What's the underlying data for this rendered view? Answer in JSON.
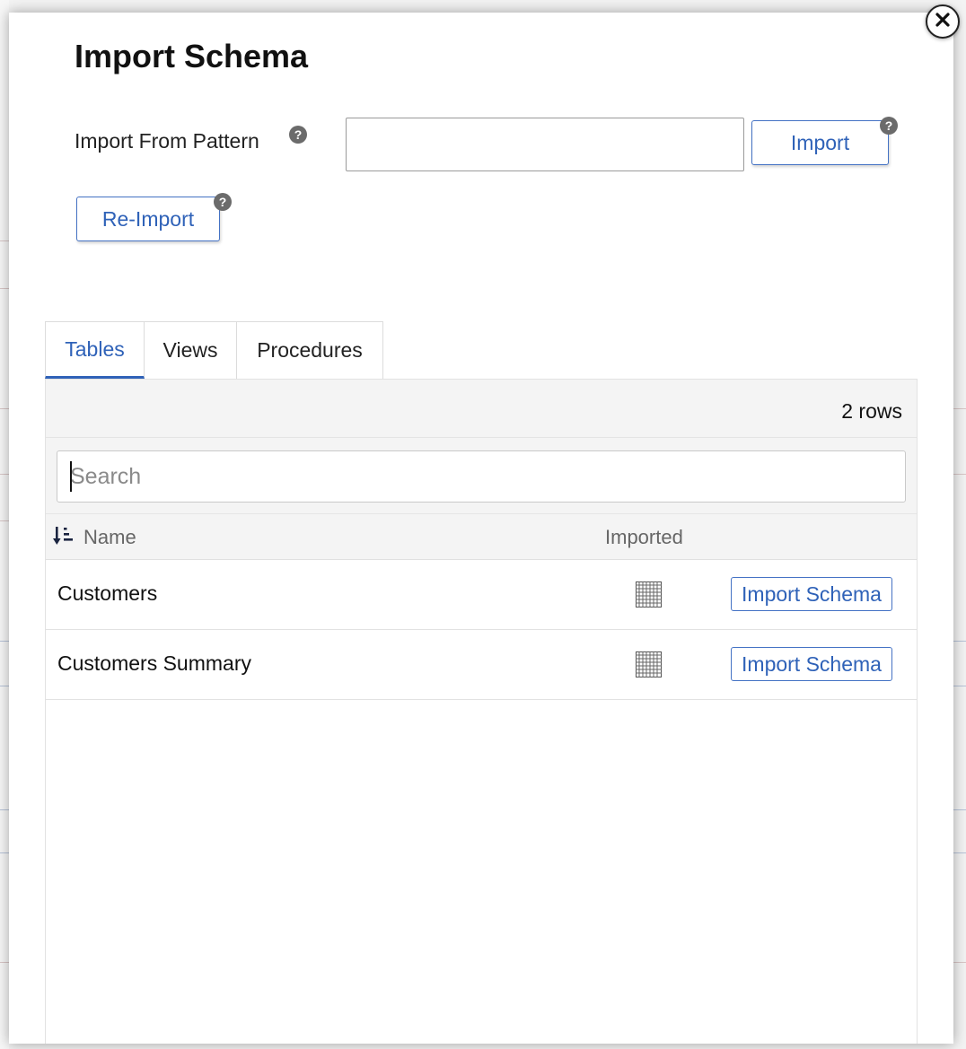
{
  "modal": {
    "title": "Import Schema",
    "close_icon": "close-icon"
  },
  "pattern": {
    "label": "Import From Pattern",
    "input_value": "",
    "import_label": "Import",
    "reimport_label": "Re-Import",
    "help_glyph": "?"
  },
  "tabs": [
    {
      "label": "Tables",
      "active": true
    },
    {
      "label": "Views",
      "active": false
    },
    {
      "label": "Procedures",
      "active": false
    }
  ],
  "table": {
    "rows_count": "2 rows",
    "search_placeholder": "Search",
    "search_value": "",
    "columns": {
      "name": "Name",
      "imported": "Imported"
    },
    "rows": [
      {
        "name": "Customers",
        "imported_icon": "table-grid-icon",
        "action": "Import Schema"
      },
      {
        "name": "Customers Summary",
        "imported_icon": "table-grid-icon",
        "action": "Import Schema"
      }
    ]
  },
  "colors": {
    "accent": "#2f62b8",
    "help_icon": "#6b6b6b",
    "header_bg": "#f4f4f4"
  }
}
